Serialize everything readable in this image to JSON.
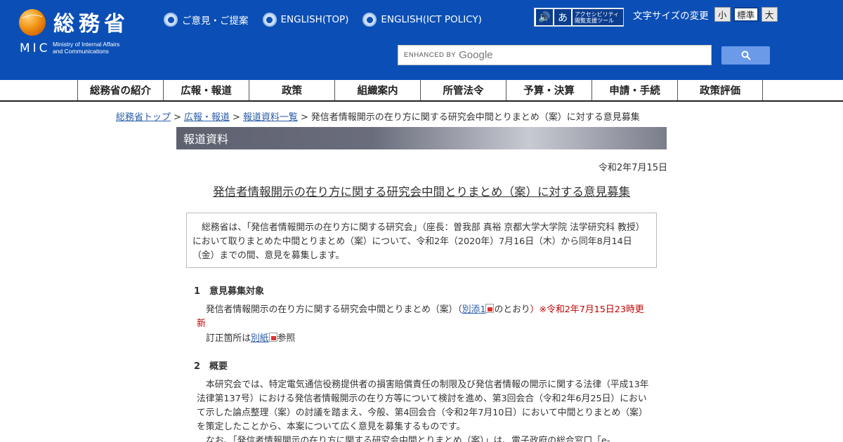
{
  "header": {
    "logo_kanji": "総務省",
    "logo_mic": "MIC",
    "logo_ministry_line1": "Ministry of Internal Affairs",
    "logo_ministry_line2": "and Communications",
    "links": [
      "ご意見・ご提案",
      "ENGLISH(TOP)",
      "ENGLISH(ICT POLICY)"
    ],
    "accessibility_line1": "アクセシビリティ",
    "accessibility_line2": "閲覧支援ツール",
    "font_size_label": "文字サイズの変更",
    "font_small": "小",
    "font_standard": "標準",
    "font_large": "大",
    "search_enhanced": "ENHANCED BY",
    "search_google": "Google"
  },
  "nav": [
    "総務省の紹介",
    "広報・報道",
    "政策",
    "組織案内",
    "所管法令",
    "予算・決算",
    "申請・手続",
    "政策評価"
  ],
  "breadcrumb": {
    "items": [
      "総務省トップ",
      "広報・報道",
      "報道資料一覧"
    ],
    "separator": ">",
    "current": "発信者情報開示の在り方に関する研究会中間とりまとめ（案）に対する意見募集"
  },
  "banner": "報道資料",
  "date": "令和2年7月15日",
  "title": "発信者情報開示の在り方に関する研究会中間とりまとめ（案）に対する意見募集",
  "summary": "総務省は、「発信者情報開示の在り方に関する研究会」（座長：曽我部 真裕 京都大学大学院 法学研究科 教授）において取りまとめた中間とりまとめ（案）について、令和2年（2020年）7月16日（木）から同年8月14日（金）までの間、意見を募集します。",
  "section1": {
    "heading": "1　意見募集対象",
    "line1_pre": "発信者情報開示の在り方に関する研究会中間とりまとめ（案）（",
    "line1_link": "別添1",
    "line1_post": "のとおり",
    "line1_note": "）※令和2年7月15日23時更新",
    "line2_pre": "訂正箇所は",
    "line2_link": "別紙",
    "line2_post": "参照"
  },
  "section2": {
    "heading": "2　概要",
    "body": "本研究会では、特定電気通信役務提供者の損害賠償責任の制限及び発信者情報の開示に関する法律（平成13年法律第137号）における発信者情報開示の在り方等について検討を進め、第3回会合（令和2年6月25日）において示した論点整理（案）の討議を踏まえ、今般、第4回会合（令和2年7月10日）において中間とりまとめ（案）を策定したことから、本案について広く意見を募集するものです。",
    "body2": "なお、「発信者情報開示の在り方に関する研究会中間とりまとめ（案）」は、電子政府の総合窓口「e-"
  }
}
